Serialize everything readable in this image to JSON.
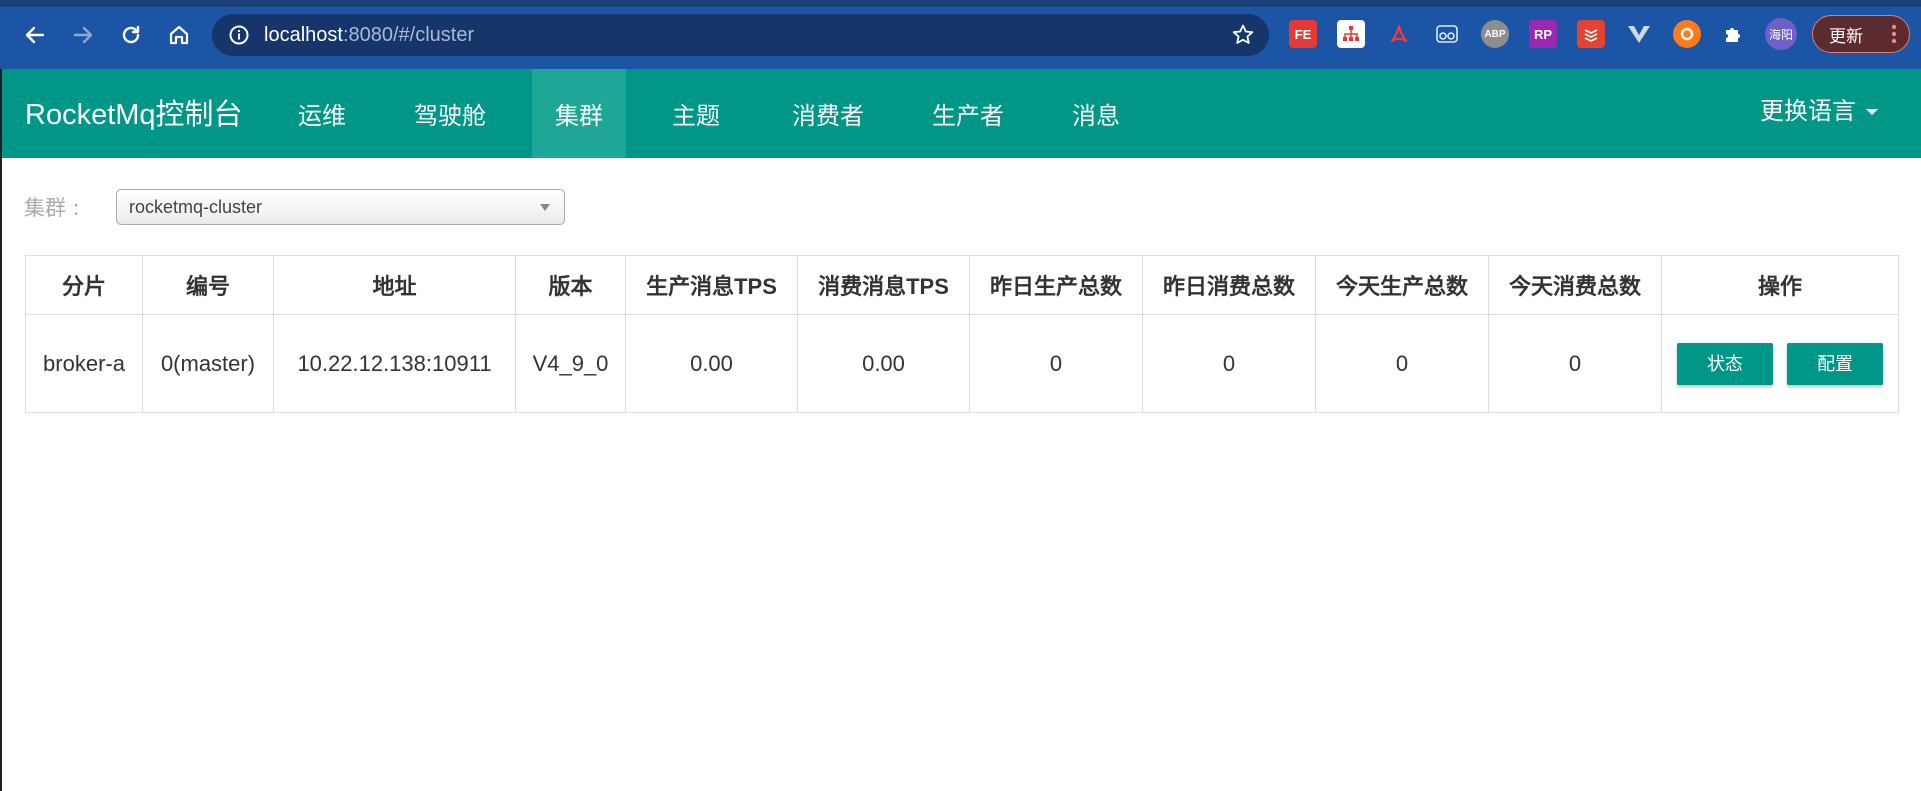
{
  "browser": {
    "url_host": "localhost",
    "url_rest": ":8080/#/cluster",
    "extensions": [
      {
        "name": "fe-helper",
        "text": "FE",
        "bg": "#e53935",
        "color": "#ffffff"
      },
      {
        "name": "sitemap-extension",
        "text": "",
        "bg": "#ffffff",
        "color": "#e53935"
      },
      {
        "name": "acrobat-extension",
        "text": "",
        "bg": "transparent",
        "color": "#e53935"
      },
      {
        "name": "reader-extension",
        "text": "",
        "bg": "transparent",
        "color": "#dfe6f2"
      },
      {
        "name": "abp-extension",
        "text": "ABP",
        "bg": "#8d8d8d",
        "color": "#ffffff"
      },
      {
        "name": "rp-extension",
        "text": "RP",
        "bg": "#9c27b0",
        "color": "#ffffff"
      },
      {
        "name": "todoist-extension",
        "text": "",
        "bg": "#e44332",
        "color": "#ffffff"
      },
      {
        "name": "vue-devtools-extension",
        "text": "",
        "bg": "transparent",
        "color": "#cfd8e6"
      },
      {
        "name": "lifebuoy-extension",
        "text": "",
        "bg": "#ff7a1a",
        "color": "#ffffff"
      },
      {
        "name": "extensions-puzzle",
        "text": "",
        "bg": "transparent",
        "color": "#ffffff"
      }
    ],
    "profile_name": "海阳",
    "update_label": "更新"
  },
  "app": {
    "brand": "RocketMq控制台",
    "nav": [
      "运维",
      "驾驶舱",
      "集群",
      "主题",
      "消费者",
      "生产者",
      "消息"
    ],
    "active_nav": "集群",
    "language_label": "更换语言"
  },
  "filter": {
    "label": "集群 :",
    "selected": "rocketmq-cluster"
  },
  "table": {
    "headers": [
      "分片",
      "编号",
      "地址",
      "版本",
      "生产消息TPS",
      "消费消息TPS",
      "昨日生产总数",
      "昨日消费总数",
      "今天生产总数",
      "今天消费总数",
      "操作"
    ],
    "rows": [
      {
        "shard": "broker-a",
        "id": "0(master)",
        "address": "10.22.12.138:10911",
        "version": "V4_9_0",
        "produce_tps": "0.00",
        "consume_tps": "0.00",
        "yesterday_produce": "0",
        "yesterday_consume": "0",
        "today_produce": "0",
        "today_consume": "0",
        "actions": [
          "状态",
          "配置"
        ]
      }
    ]
  },
  "colors": {
    "primary": "#009688",
    "nav_active": "#1ea796",
    "browser_bar": "#1c55a6"
  }
}
